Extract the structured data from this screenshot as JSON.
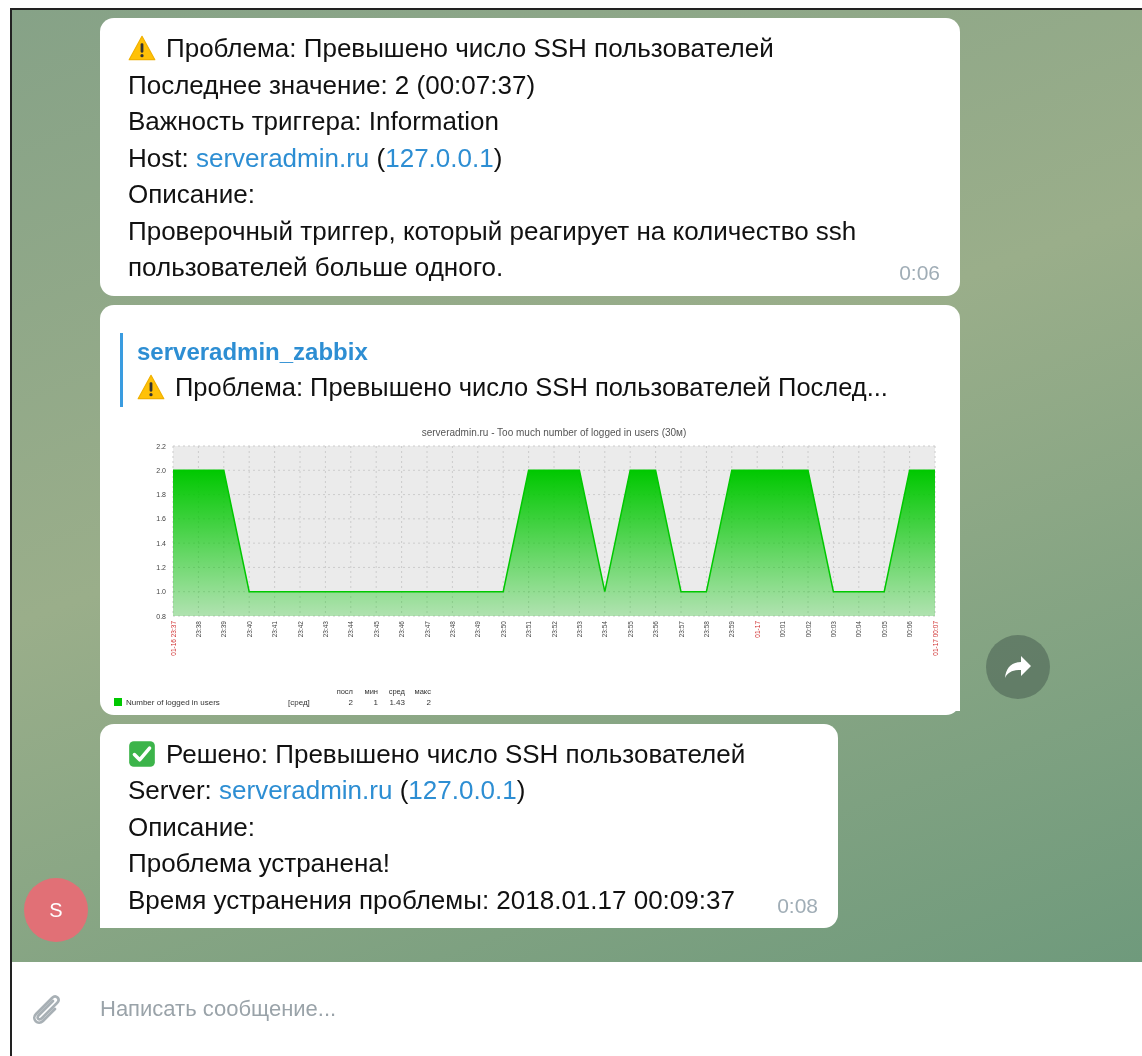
{
  "messages": [
    {
      "kind": "text",
      "lines": [
        {
          "kind": "alert",
          "parts": [
            {
              "kind": "text",
              "text": "Проблема: Превышено число SSH пользователей"
            }
          ]
        },
        {
          "kind": "plain",
          "parts": [
            {
              "kind": "text",
              "text": "Последнее значение: 2 (00:07:37)"
            }
          ]
        },
        {
          "kind": "plain",
          "parts": [
            {
              "kind": "text",
              "text": "Важность триггера: Information"
            }
          ]
        },
        {
          "kind": "plain",
          "parts": [
            {
              "kind": "text",
              "text": "Host: "
            },
            {
              "kind": "link",
              "text": "serveradmin.ru"
            },
            {
              "kind": "text",
              "text": " ("
            },
            {
              "kind": "link",
              "text": "127.0.0.1"
            },
            {
              "kind": "text",
              "text": ")"
            }
          ]
        },
        {
          "kind": "plain",
          "parts": [
            {
              "kind": "text",
              "text": "Описание:"
            }
          ]
        },
        {
          "kind": "plain",
          "parts": [
            {
              "kind": "text",
              "text": "Проверочный триггер, который реагирует на количество ssh"
            }
          ]
        },
        {
          "kind": "plain",
          "parts": [
            {
              "kind": "text",
              "text": "пользователей больше одного."
            }
          ]
        }
      ],
      "time": "0:06"
    },
    {
      "kind": "reply",
      "author": "serveradmin_zabbix",
      "quote": {
        "kind": "alert",
        "text": "Проблема: Превышено число SSH пользователей Послед..."
      },
      "chart": {
        "chart_data": {
          "type": "area",
          "title": "serveradmin.ru - Too much number of logged in users (30м)",
          "categories": [
            "01-16 23:37",
            "23:38",
            "23:39",
            "23:40",
            "23:41",
            "23:42",
            "23:43",
            "23:44",
            "23:45",
            "23:46",
            "23:47",
            "23:48",
            "23:49",
            "23:50",
            "23:51",
            "23:52",
            "23:53",
            "23:54",
            "23:55",
            "23:56",
            "23:57",
            "23:58",
            "23:59",
            "01-17",
            "00:01",
            "00:02",
            "00:03",
            "00:04",
            "00:05",
            "00:06",
            "01-17 00:07"
          ],
          "series": [
            {
              "name": "Number of logged in users",
              "color": "#00c800",
              "values": [
                2,
                2,
                2,
                1,
                1,
                1,
                1,
                1,
                1,
                1,
                1,
                1,
                1,
                1,
                2,
                2,
                2,
                1,
                2,
                2,
                1,
                1,
                2,
                2,
                2,
                2,
                1,
                1,
                1,
                2,
                2
              ]
            }
          ],
          "grid": true,
          "ylim": [
            0.8,
            2.2
          ],
          "yticks": [
            {
              "value": 0.8,
              "label": "0.8"
            },
            {
              "value": 1.0,
              "label": "1.0"
            },
            {
              "value": 1.2,
              "label": "1.2"
            },
            {
              "value": 1.4,
              "label": "1.4"
            },
            {
              "value": 1.6,
              "label": "1.6"
            },
            {
              "value": 1.8,
              "label": "1.8"
            },
            {
              "value": 2.0,
              "label": "2.0"
            },
            {
              "value": 2.2,
              "label": "2.2"
            }
          ]
        },
        "date_flags": [
          true,
          false,
          false,
          false,
          false,
          false,
          false,
          false,
          false,
          false,
          false,
          false,
          false,
          false,
          false,
          false,
          false,
          false,
          false,
          false,
          false,
          false,
          false,
          true,
          false,
          false,
          false,
          false,
          false,
          false,
          true
        ],
        "legend": {
          "aggregate": "[сред]",
          "columns": [
            "посл",
            "мин",
            "сред",
            "макс"
          ],
          "values": [
            "2",
            "1",
            "1.43",
            "2"
          ]
        }
      }
    },
    {
      "kind": "text",
      "lines": [
        {
          "kind": "resolved",
          "parts": [
            {
              "kind": "text",
              "text": "Решено: Превышено число SSH пользователей"
            }
          ]
        },
        {
          "kind": "plain",
          "parts": [
            {
              "kind": "text",
              "text": "Server: "
            },
            {
              "kind": "link",
              "text": "serveradmin.ru"
            },
            {
              "kind": "text",
              "text": " ("
            },
            {
              "kind": "link",
              "text": "127.0.0.1"
            },
            {
              "kind": "text",
              "text": ")"
            }
          ]
        },
        {
          "kind": "plain",
          "parts": [
            {
              "kind": "text",
              "text": "Описание:"
            }
          ]
        },
        {
          "kind": "plain",
          "parts": [
            {
              "kind": "text",
              "text": "Проблема устранена!"
            }
          ]
        },
        {
          "kind": "plain",
          "parts": [
            {
              "kind": "text",
              "text": "Время устранения проблемы: 2018.01.17 00:09:37"
            }
          ]
        }
      ],
      "time": "0:08"
    }
  ],
  "sender": {
    "initial": "S"
  },
  "composer": {
    "placeholder": "Написать сообщение..."
  }
}
